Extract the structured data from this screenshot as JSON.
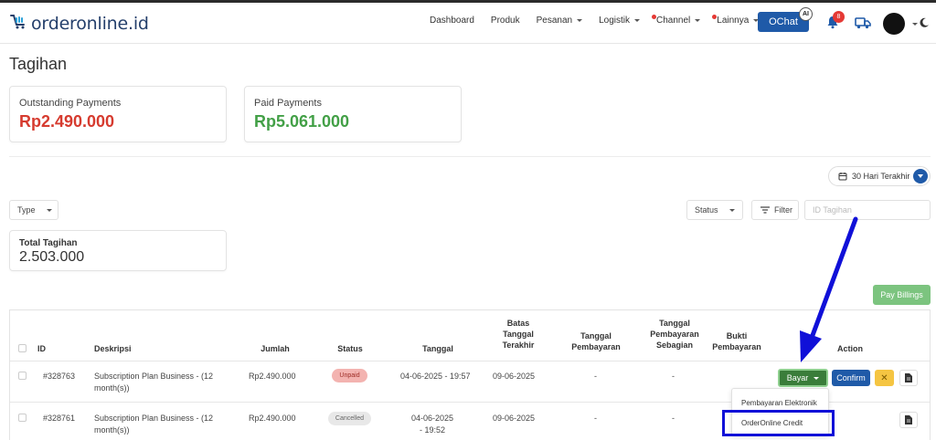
{
  "app": {
    "logo_text": "orderonline.id"
  },
  "nav": {
    "items": [
      {
        "label": "Dashboard",
        "caret": false,
        "dot": false
      },
      {
        "label": "Produk",
        "caret": false,
        "dot": false
      },
      {
        "label": "Pesanan",
        "caret": true,
        "dot": false
      },
      {
        "label": "Logistik",
        "caret": true,
        "dot": false
      },
      {
        "label": "Channel",
        "caret": true,
        "dot": true
      },
      {
        "label": "Lainnya",
        "caret": true,
        "dot": true
      }
    ],
    "ochat_label": "OChat",
    "ai_badge": "AI",
    "notification_count": "8"
  },
  "page": {
    "title": "Tagihan"
  },
  "summary": {
    "outstanding_label": "Outstanding Payments",
    "outstanding_value": "Rp2.490.000",
    "paid_label": "Paid Payments",
    "paid_value": "Rp5.061.000",
    "total_label": "Total Tagihan",
    "total_value": "2.503.000"
  },
  "filters": {
    "date_range": "30 Hari Terakhir",
    "type_label": "Type",
    "status_label": "Status",
    "filter_label": "Filter",
    "search_placeholder": "ID Tagihan"
  },
  "actions": {
    "pay_billings": "Pay Billings"
  },
  "table": {
    "headers": {
      "id": "ID",
      "desc": "Deskripsi",
      "amount": "Jumlah",
      "status": "Status",
      "date": "Tanggal",
      "due": "Batas Tanggal Terakhir",
      "paid_date": "Tanggal Pembayaran",
      "partial_date": "Tanggal Pembayaran Sebagian",
      "proof": "Bukti Pembayaran",
      "action": "Action"
    },
    "rows": [
      {
        "id": "#328763",
        "desc": "Subscription Plan Business - (12 month(s))",
        "amount": "Rp2.490.000",
        "status": "Unpaid",
        "date": "04-06-2025 - 19:57",
        "due": "09-06-2025",
        "paid_date": "-",
        "partial_date": "-"
      },
      {
        "id": "#328761",
        "desc": "Subscription Plan Business - (12 month(s))",
        "amount": "Rp2.490.000",
        "status": "Cancelled",
        "date": "04-06-2025 - 19:52",
        "due": "09-06-2025",
        "paid_date": "-",
        "partial_date": "-"
      }
    ],
    "row_actions": {
      "bayar": "Bayar",
      "confirm": "Confirm",
      "cancel": "✕"
    }
  },
  "dropdown": {
    "items": [
      "Pembayaran Elektronik",
      "OrderOnline Credit"
    ]
  },
  "icons": [
    "cart-logo-icon",
    "bell-icon",
    "truck-icon",
    "avatar",
    "moon-icon",
    "calendar-icon",
    "filter-icon",
    "document-icon",
    "chevron-down-icon"
  ],
  "colors": {
    "brand": "#1f5aa8",
    "outstanding": "#d63b2f",
    "paid": "#43a047",
    "bayar": "#3a7d3a",
    "cancel": "#f5c542",
    "unpaid_badge": "#f3b3b0",
    "annotation": "#1010d8"
  }
}
